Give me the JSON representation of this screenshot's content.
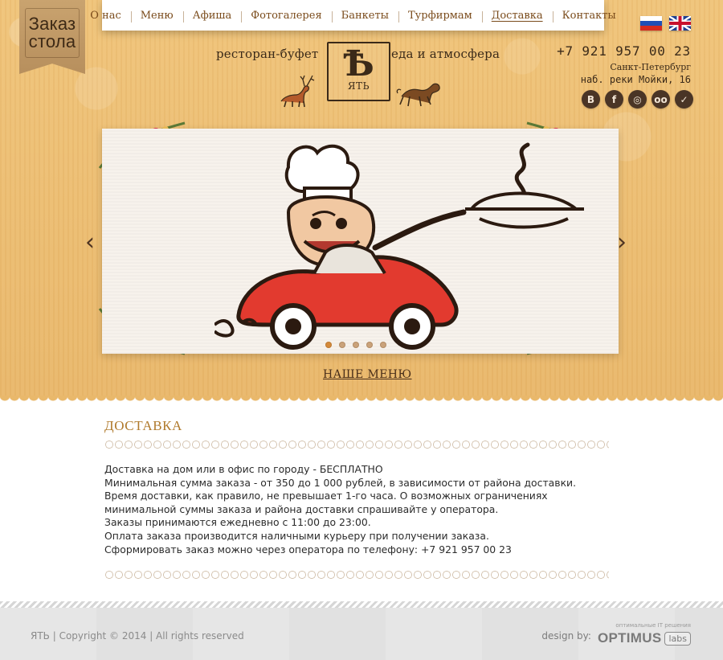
{
  "header": {
    "order_ribbon": {
      "line1": "Заказ",
      "line2": "стола"
    },
    "nav": [
      {
        "label": "О нас",
        "active": false
      },
      {
        "label": "Меню",
        "active": false
      },
      {
        "label": "Афиша",
        "active": false
      },
      {
        "label": "Фотогалерея",
        "active": false
      },
      {
        "label": "Банкеты",
        "active": false
      },
      {
        "label": "Турфирмам",
        "active": false
      },
      {
        "label": "Доставка",
        "active": true
      },
      {
        "label": "Контакты",
        "active": false
      }
    ],
    "languages": [
      {
        "code": "ru",
        "icon": "flag-russia-icon"
      },
      {
        "code": "en",
        "icon": "flag-uk-icon"
      }
    ],
    "slogan_left": "ресторан-буфет",
    "slogan_right": "еда и атмосфера",
    "logo": {
      "letter": "Ѣ",
      "word": "ЯТЬ"
    },
    "contacts": {
      "phone": "+7 921 957 00 23",
      "city": "Санкт-Петербург",
      "address": "наб. реки Мойки, 16"
    },
    "social": [
      {
        "name": "vk",
        "glyph": "B"
      },
      {
        "name": "facebook",
        "glyph": "f"
      },
      {
        "name": "instagram",
        "glyph": "◎"
      },
      {
        "name": "tripadvisor",
        "glyph": "oo"
      },
      {
        "name": "foursquare",
        "glyph": "✓"
      }
    ]
  },
  "slider": {
    "prev_icon": "chevron-left-icon",
    "next_icon": "chevron-right-icon",
    "dots_total": 5,
    "active_dot": 1,
    "menu_link": "НАШЕ МЕНЮ"
  },
  "content": {
    "title": "ДОСТАВКА",
    "lines": [
      "Доставка на дом или в офис по городу - БЕСПЛАТНО",
      "Минимальная сумма заказа - от 350 до 1 000 рублей, в зависимости от района доставки.",
      "Время доставки, как правило, не превышает 1-го часа.  О возможных ограничениях  минимальной суммы заказа и района доставки  спрашивайте у оператора.",
      "Заказы принимаются ежедневно с 11:00 до 23:00.",
      "Оплата заказа производится наличными курьеру при получении заказа.",
      "Сформировать заказ можно через оператора по телефону: +7 921 957 00 23"
    ]
  },
  "footer": {
    "left": "ЯТЬ  |  Copyright  ©  2014  |  All rights reserved",
    "design_by": "design by:",
    "optimus_tagline": "оптимальные IT решения",
    "optimus_brand": "OPTIMUS",
    "optimus_labs": "labs"
  },
  "colors": {
    "header_bg": "#e9b86b",
    "nav_text": "#7a4b1b",
    "title": "#b07a2c",
    "footer_bg": "#e6e6e6"
  }
}
